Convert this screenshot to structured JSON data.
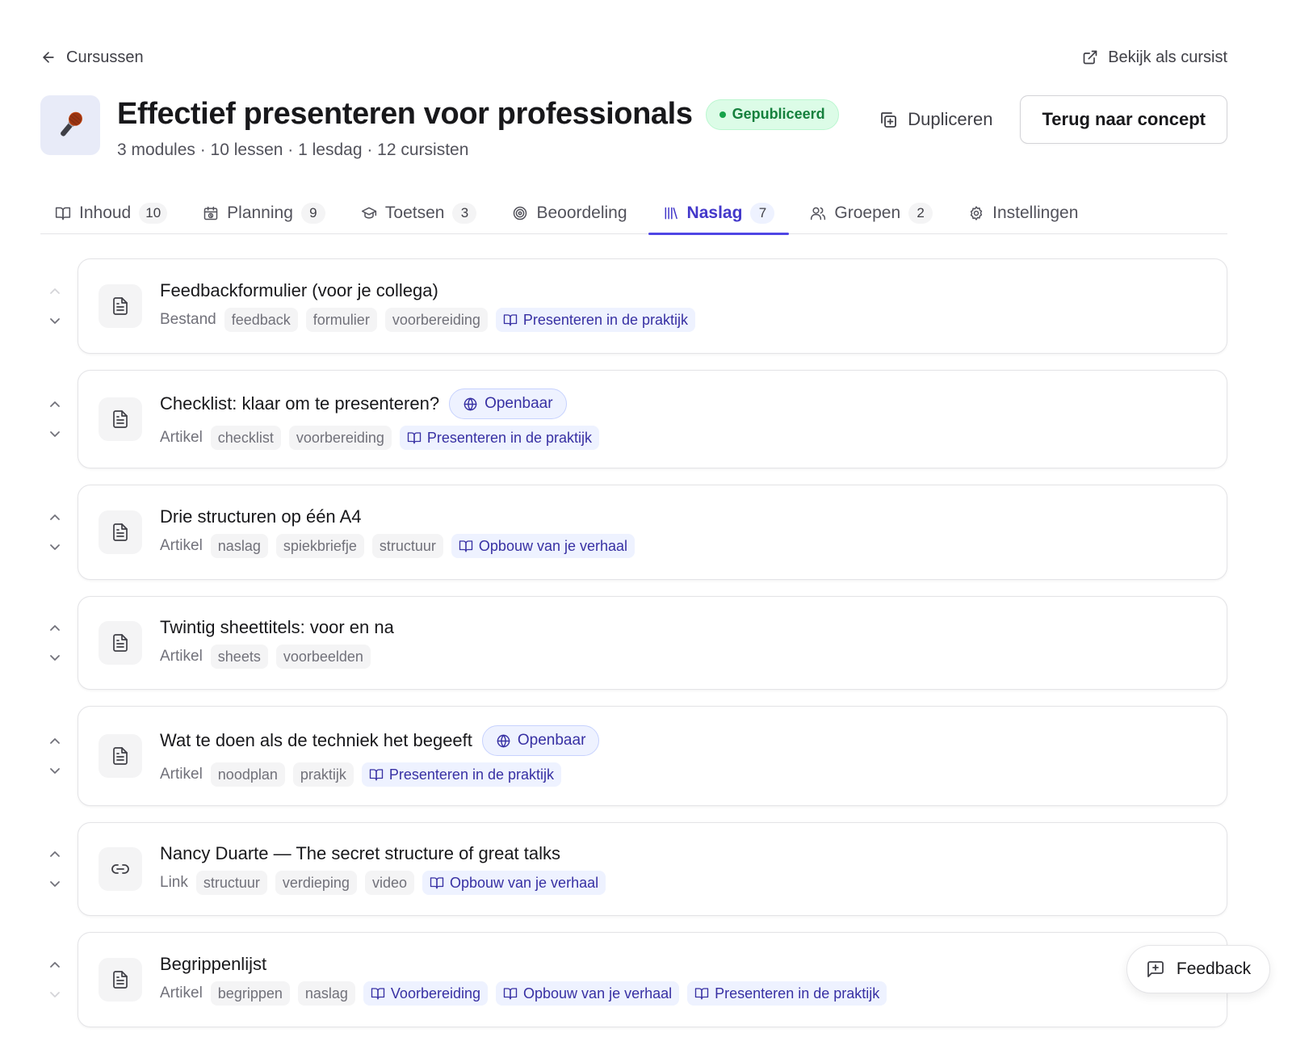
{
  "nav": {
    "back_label": "Cursussen",
    "preview_label": "Bekijk als cursist"
  },
  "course": {
    "icon": "microphone-icon",
    "title": "Effectief presenteren voor professionals",
    "status": "Gepubliceerd",
    "meta": "3 modules · 10 lessen · 1 lesdag · 12 cursisten",
    "duplicate_label": "Dupliceren",
    "concept_label": "Terug naar concept"
  },
  "tabs": [
    {
      "label": "Inhoud",
      "count": "10",
      "icon": "book-open-icon",
      "active": false
    },
    {
      "label": "Planning",
      "count": "9",
      "icon": "calendar-icon",
      "active": false
    },
    {
      "label": "Toetsen",
      "count": "3",
      "icon": "graduation-cap-icon",
      "active": false
    },
    {
      "label": "Beoordeling",
      "count": "",
      "icon": "target-icon",
      "active": false
    },
    {
      "label": "Naslag",
      "count": "7",
      "icon": "library-icon",
      "active": true
    },
    {
      "label": "Groepen",
      "count": "2",
      "icon": "users-icon",
      "active": false
    },
    {
      "label": "Instellingen",
      "count": "",
      "icon": "settings-icon",
      "active": false
    }
  ],
  "items": [
    {
      "title": "Feedbackformulier (voor je collega)",
      "type": "Bestand",
      "icon": "file-text-icon",
      "public": "",
      "tags": [
        "feedback",
        "formulier",
        "voorbereiding"
      ],
      "modules": [
        "Presenteren in de praktijk"
      ]
    },
    {
      "title": "Checklist: klaar om te presenteren?",
      "type": "Artikel",
      "icon": "file-text-icon",
      "public": "Openbaar",
      "tags": [
        "checklist",
        "voorbereiding"
      ],
      "modules": [
        "Presenteren in de praktijk"
      ]
    },
    {
      "title": "Drie structuren op één A4",
      "type": "Artikel",
      "icon": "file-text-icon",
      "public": "",
      "tags": [
        "naslag",
        "spiekbriefje",
        "structuur"
      ],
      "modules": [
        "Opbouw van je verhaal"
      ]
    },
    {
      "title": "Twintig sheettitels: voor en na",
      "type": "Artikel",
      "icon": "file-text-icon",
      "public": "",
      "tags": [
        "sheets",
        "voorbeelden"
      ],
      "modules": []
    },
    {
      "title": "Wat te doen als de techniek het begeeft",
      "type": "Artikel",
      "icon": "file-text-icon",
      "public": "Openbaar",
      "tags": [
        "noodplan",
        "praktijk"
      ],
      "modules": [
        "Presenteren in de praktijk"
      ]
    },
    {
      "title": "Nancy Duarte — The secret structure of great talks",
      "type": "Link",
      "icon": "link-icon",
      "public": "",
      "tags": [
        "structuur",
        "verdieping",
        "video"
      ],
      "modules": [
        "Opbouw van je verhaal"
      ]
    },
    {
      "title": "Begrippenlijst",
      "type": "Artikel",
      "icon": "file-text-icon",
      "public": "",
      "tags": [
        "begrippen",
        "naslag"
      ],
      "modules": [
        "Voorbereiding",
        "Opbouw van je verhaal",
        "Presenteren in de praktijk"
      ]
    }
  ],
  "feedback_label": "Feedback",
  "colors": {
    "accent": "#4f46e5",
    "published_bg": "#dcfce7",
    "published_text": "#15803d",
    "module_tag_bg": "#eef2ff",
    "module_tag_text": "#3730a3"
  }
}
